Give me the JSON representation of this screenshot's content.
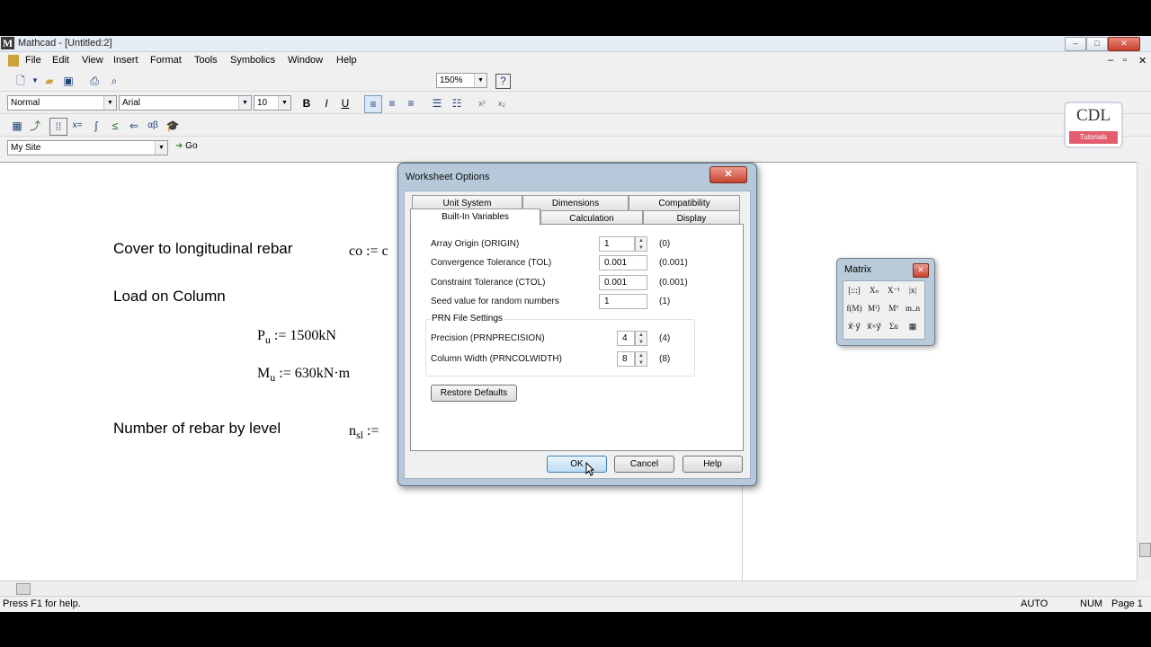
{
  "window": {
    "title": "Mathcad - [Untitled:2]",
    "logo_letter": "M",
    "min": "–",
    "max": "□",
    "close": "✕"
  },
  "menu": [
    "File",
    "Edit",
    "View",
    "Insert",
    "Format",
    "Tools",
    "Symbolics",
    "Window",
    "Help"
  ],
  "toolbar": {
    "zoom": "150%",
    "style": "Normal",
    "font": "Arial",
    "size": "10",
    "bold": "B",
    "italic": "I",
    "underline": "U",
    "site": "My Site",
    "go": "Go"
  },
  "worksheet": {
    "cover_label": "Cover to longitudinal rebar",
    "co_expr": "co := c",
    "load_label": "Load on Column",
    "pu_var": "P",
    "pu_sub": "u",
    "pu_val": " := 1500kN",
    "mu_var": "M",
    "mu_sub": "u",
    "mu_val": " := 630kN·m",
    "rebar_label": "Number of rebar by level",
    "nsl_var": "n",
    "nsl_sub": "sl",
    "nsl_val": " :="
  },
  "watermark": {
    "line1": "CDL",
    "line2": "Tutorials"
  },
  "dialog": {
    "title": "Worksheet Options",
    "close": "✕",
    "tabs_back": [
      "Unit System",
      "Dimensions",
      "Compatibility"
    ],
    "tabs_front": [
      "Built-In Variables",
      "Calculation",
      "Display"
    ],
    "rows": [
      {
        "label": "Array Origin  (ORIGIN)",
        "value": "1",
        "default": "(0)"
      },
      {
        "label": "Convergence Tolerance  (TOL)",
        "value": "0.001",
        "default": "(0.001)"
      },
      {
        "label": "Constraint Tolerance  (CTOL)",
        "value": "0.001",
        "default": "(0.001)"
      },
      {
        "label": "Seed value for random numbers",
        "value": "1",
        "default": "(1)"
      }
    ],
    "prn_group": "PRN File Settings",
    "prn_rows": [
      {
        "label": "Precision  (PRNPRECISION)",
        "value": "4",
        "default": "(4)"
      },
      {
        "label": "Column Width  (PRNCOLWIDTH)",
        "value": "8",
        "default": "(8)"
      }
    ],
    "restore": "Restore Defaults",
    "ok": "OK",
    "cancel": "Cancel",
    "help": "Help"
  },
  "matrix_palette": {
    "title": "Matrix",
    "close": "✕",
    "icons": [
      "[:::]",
      "Xₙ",
      "X⁻¹",
      "|x|",
      "f(M)",
      "M⁽⟩",
      "Mᵀ",
      "m..n",
      "x⃗·y⃗",
      "x⃗×y⃗",
      "Σu",
      "▦"
    ]
  },
  "status": {
    "help": "Press F1 for help.",
    "auto": "AUTO",
    "num": "NUM",
    "page": "Page 1"
  }
}
